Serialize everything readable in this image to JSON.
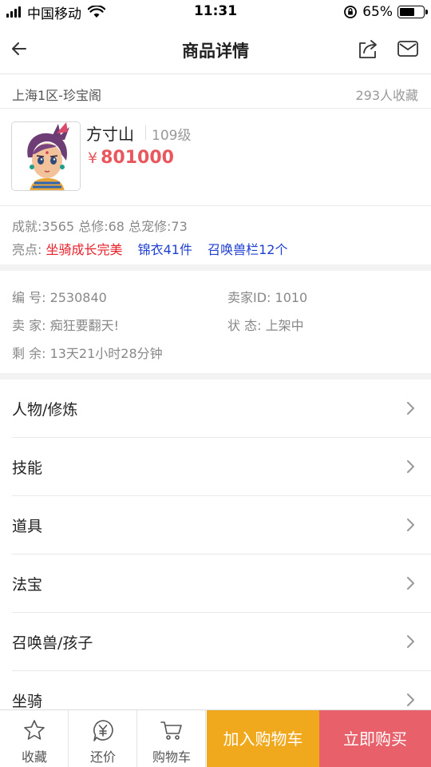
{
  "status_bar": {
    "carrier": "中国移动",
    "time": "11:31",
    "battery_percent": "65%",
    "battery_level": 0.65
  },
  "nav": {
    "title": "商品详情",
    "back_icon": "back-arrow-icon",
    "share_icon": "share-icon",
    "mail_icon": "mail-icon"
  },
  "server": {
    "name": "上海1区-珍宝阁",
    "favorites": "293人收藏"
  },
  "character": {
    "name": "方寸山",
    "level": "109级",
    "price_symbol": "¥",
    "price": "801000"
  },
  "stats": {
    "line": "成就:3565 总修:68 总宠修:73",
    "highlight_label": "亮点:",
    "highlights_red": [
      "坐骑成长完美"
    ],
    "highlights_blue": [
      "锦衣41件",
      "召唤兽栏12个"
    ]
  },
  "info": {
    "serial": "编  号: 2530840",
    "seller_id": "卖家ID: 1010",
    "seller": "卖  家: 痴狂要翻天!",
    "status": "状  态: 上架中",
    "remaining": "剩  余: 13天21小时28分钟"
  },
  "categories": [
    {
      "label": "人物/修炼"
    },
    {
      "label": "技能"
    },
    {
      "label": "道具"
    },
    {
      "label": "法宝"
    },
    {
      "label": "召唤兽/孩子"
    },
    {
      "label": "坐骑"
    }
  ],
  "bottom_bar": {
    "favorite_label": "收藏",
    "bargain_label": "还价",
    "cart_label": "购物车",
    "add_to_cart_label": "加入购物车",
    "buy_now_label": "立即购买"
  },
  "colors": {
    "price_red": "#e8575d",
    "highlight_red": "#e8202a",
    "highlight_blue": "#1f3fd1",
    "add_to_cart_bg": "#f0a81c",
    "buy_now_bg": "#e8606a"
  }
}
